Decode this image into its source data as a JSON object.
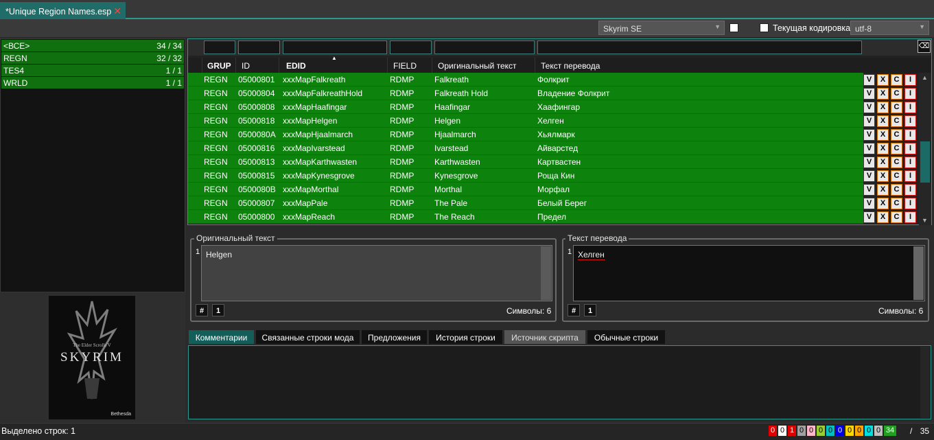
{
  "file_tab": {
    "title": "*Unique Region Names.esp",
    "close_glyph": "✕"
  },
  "toolbar": {
    "game_select": "Skyrim SE",
    "encoding_checkbox_label": "Текущая кодировка",
    "encoding_select": "utf-8"
  },
  "left_list": [
    {
      "name": "<ВСЕ>",
      "count": "34 / 34"
    },
    {
      "name": "REGN",
      "count": "32 / 32"
    },
    {
      "name": "TES4",
      "count": "1 / 1"
    },
    {
      "name": "WRLD",
      "count": "1 / 1"
    }
  ],
  "cover": {
    "small_title": "The Elder Scrolls V",
    "title": "SKYRIM",
    "publisher": "Bethesda"
  },
  "grid": {
    "headers": [
      "GRUP",
      "ID",
      "EDID",
      "FIELD",
      "Оригинальный текст",
      "Текст перевода"
    ],
    "sort_glyph": "▲",
    "eraser_glyph": "⌫",
    "action_labels": [
      "V",
      "X",
      "C",
      "I"
    ],
    "rows": [
      {
        "grup": "REGN",
        "id": "05000801",
        "edid": "xxxMapFalkreath",
        "field": "RDMP",
        "orig": "Falkreath",
        "trans": "Фолкрит"
      },
      {
        "grup": "REGN",
        "id": "05000804",
        "edid": "xxxMapFalkreathHold",
        "field": "RDMP",
        "orig": "Falkreath Hold",
        "trans": "Владение Фолкрит"
      },
      {
        "grup": "REGN",
        "id": "05000808",
        "edid": "xxxMapHaafingar",
        "field": "RDMP",
        "orig": "Haafingar",
        "trans": "Хаафингар"
      },
      {
        "grup": "REGN",
        "id": "05000818",
        "edid": "xxxMapHelgen",
        "field": "RDMP",
        "orig": "Helgen",
        "trans": "Хелген"
      },
      {
        "grup": "REGN",
        "id": "0500080A",
        "edid": "xxxMapHjaalmarch",
        "field": "RDMP",
        "orig": "Hjaalmarch",
        "trans": "Хьялмарк"
      },
      {
        "grup": "REGN",
        "id": "05000816",
        "edid": "xxxMapIvarstead",
        "field": "RDMP",
        "orig": "Ivarstead",
        "trans": "Айварстед"
      },
      {
        "grup": "REGN",
        "id": "05000813",
        "edid": "xxxMapKarthwasten",
        "field": "RDMP",
        "orig": "Karthwasten",
        "trans": "Картвастен"
      },
      {
        "grup": "REGN",
        "id": "05000815",
        "edid": "xxxMapKynesgrove",
        "field": "RDMP",
        "orig": "Kynesgrove",
        "trans": "Роща Кин"
      },
      {
        "grup": "REGN",
        "id": "0500080B",
        "edid": "xxxMapMorthal",
        "field": "RDMP",
        "orig": "Morthal",
        "trans": "Морфал"
      },
      {
        "grup": "REGN",
        "id": "05000807",
        "edid": "xxxMapPale",
        "field": "RDMP",
        "orig": "The Pale",
        "trans": "Белый Берег"
      },
      {
        "grup": "REGN",
        "id": "05000800",
        "edid": "xxxMapReach",
        "field": "RDMP",
        "orig": "The Reach",
        "trans": "Предел"
      }
    ]
  },
  "original_box": {
    "title": "Оригинальный текст",
    "line_no": "1",
    "text": "Helgen",
    "hash": "#",
    "one": "1",
    "symbols": "Символы: 6"
  },
  "translation_box": {
    "title": "Текст перевода",
    "line_no": "1",
    "text": "Хелген",
    "hash": "#",
    "one": "1",
    "symbols": "Символы: 6"
  },
  "bottom_tabs": [
    "Комментарии",
    "Связанные строки мода",
    "Предложения",
    "История строки",
    "Источник скрипта",
    "Обычные строки"
  ],
  "status": {
    "selected": "Выделено строк:  1",
    "counters": [
      {
        "v": "0",
        "bg": "#e00000"
      },
      {
        "v": "0",
        "bg": "#ffffff"
      },
      {
        "v": "1",
        "bg": "#e00000"
      },
      {
        "v": "0",
        "bg": "#a0a0a0"
      },
      {
        "v": "0",
        "bg": "#ffb6c8"
      },
      {
        "v": "0",
        "bg": "#9acd32"
      },
      {
        "v": "0",
        "bg": "#00c0c0"
      },
      {
        "v": "0",
        "bg": "#0000e0"
      },
      {
        "v": "0",
        "bg": "#ffd700"
      },
      {
        "v": "0",
        "bg": "#ffa500"
      },
      {
        "v": "0",
        "bg": "#00e0e0"
      },
      {
        "v": "0",
        "bg": "#c0c0c0"
      },
      {
        "v": "34",
        "bg": "#20a020"
      }
    ],
    "slash": "/",
    "total": "35"
  },
  "colors": {
    "accent": "#2b9a8e",
    "row_green": "#0d820d"
  }
}
